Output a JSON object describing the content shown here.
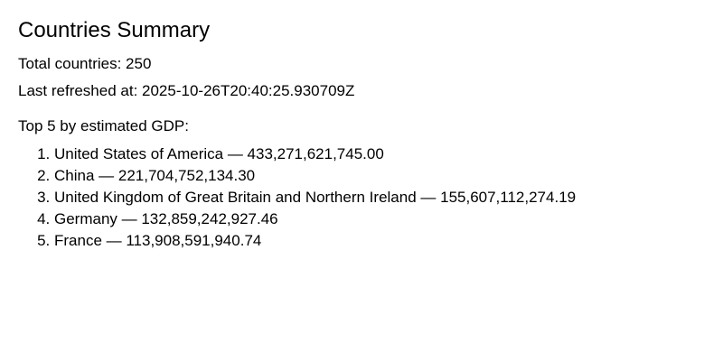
{
  "summary": {
    "title": "Countries Summary",
    "total_label": "Total countries: 250",
    "refreshed_label": "Last refreshed at: 2025-10-26T20:40:25.930709Z",
    "top_heading": "Top 5 by estimated GDP:"
  },
  "top_countries": [
    "United States of America — 433,271,621,745.00",
    "China — 221,704,752,134.30",
    "United Kingdom of Great Britain and Northern Ireland — 155,607,112,274.19",
    "Germany — 132,859,242,927.46",
    "France — 113,908,591,940.74"
  ]
}
